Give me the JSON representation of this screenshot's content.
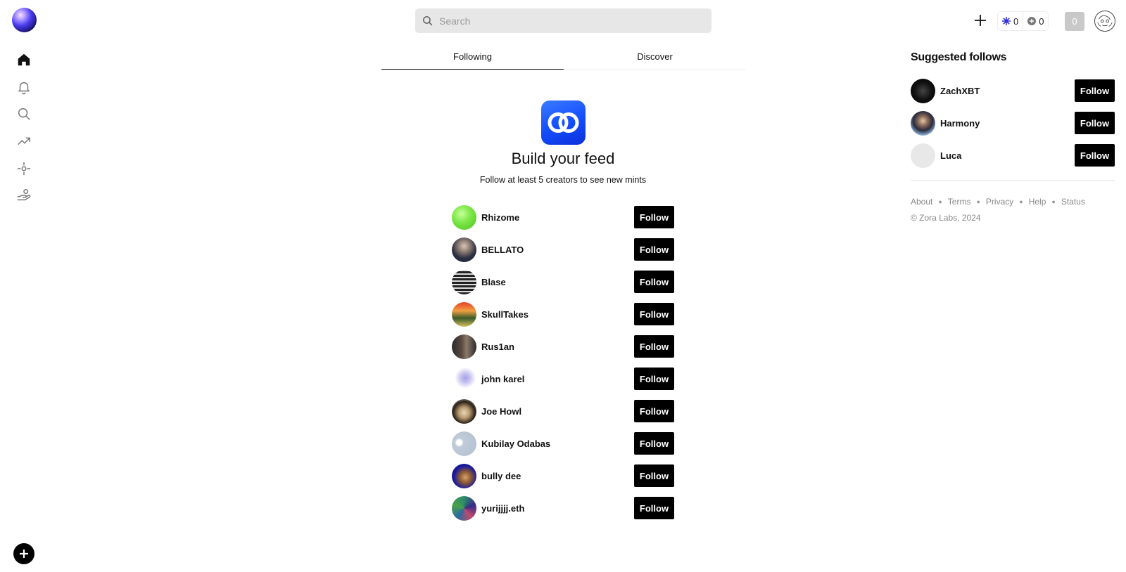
{
  "nav": {
    "items": [
      {
        "icon": "home-icon"
      },
      {
        "icon": "bell-icon"
      },
      {
        "icon": "search-icon"
      },
      {
        "icon": "trending-icon"
      },
      {
        "icon": "crosshair-icon"
      },
      {
        "icon": "hand-coin-icon"
      }
    ]
  },
  "search": {
    "placeholder": "Search"
  },
  "header": {
    "stat_sparks": "0",
    "stat_plus": "0",
    "count_button": "0"
  },
  "tabs": [
    {
      "label": "Following",
      "active": true
    },
    {
      "label": "Discover",
      "active": false
    }
  ],
  "feed": {
    "title": "Build your feed",
    "subtitle": "Follow at least 5 creators to see new mints"
  },
  "creators": [
    {
      "name": "Rhizome",
      "follow_label": "Follow"
    },
    {
      "name": "BELLATO",
      "follow_label": "Follow"
    },
    {
      "name": "Blase",
      "follow_label": "Follow"
    },
    {
      "name": "SkullTakes",
      "follow_label": "Follow"
    },
    {
      "name": "Rus1an",
      "follow_label": "Follow"
    },
    {
      "name": "john karel",
      "follow_label": "Follow"
    },
    {
      "name": "Joe Howl",
      "follow_label": "Follow"
    },
    {
      "name": "Kubilay Odabas",
      "follow_label": "Follow"
    },
    {
      "name": "bully dee",
      "follow_label": "Follow"
    },
    {
      "name": "yurijjjj.eth",
      "follow_label": "Follow"
    }
  ],
  "suggested": {
    "title": "Suggested follows",
    "items": [
      {
        "name": "ZachXBT",
        "follow_label": "Follow"
      },
      {
        "name": "Harmony",
        "follow_label": "Follow"
      },
      {
        "name": "Luca",
        "follow_label": "Follow"
      }
    ]
  },
  "footer": {
    "links": [
      "About",
      "Terms",
      "Privacy",
      "Help",
      "Status"
    ],
    "copyright": "© Zora Labs, 2024"
  },
  "colors": {
    "accent_blue": "#1550ff",
    "button_black": "#000000",
    "search_bg": "#e7e7e7"
  }
}
